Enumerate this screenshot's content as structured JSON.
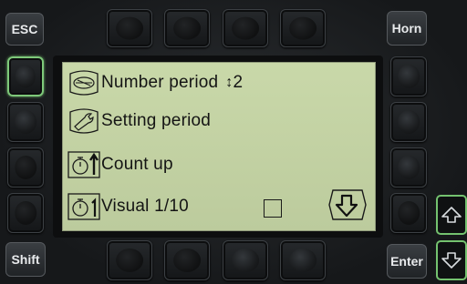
{
  "keys": {
    "esc_label": "ESC",
    "horn_label": "Horn",
    "shift_label": "Shift",
    "enter_label": "Enter"
  },
  "menu": {
    "rows": [
      {
        "label": "Number period",
        "value": "2",
        "icon": "wrench-window-icon"
      },
      {
        "label": "Setting period",
        "icon": "wrench-settings-icon"
      },
      {
        "label": "Count up",
        "icon": "stopwatch-up-icon"
      },
      {
        "label": "Visual 1/10",
        "icon": "stopwatch-1-icon"
      }
    ],
    "visual_checkbox_checked": false,
    "softkey_icon": "down-arrow-icon",
    "number_period_arrow": "↕"
  },
  "colors": {
    "lcd_background": "#c9d8a9",
    "highlight_border": "#7ec97a"
  }
}
